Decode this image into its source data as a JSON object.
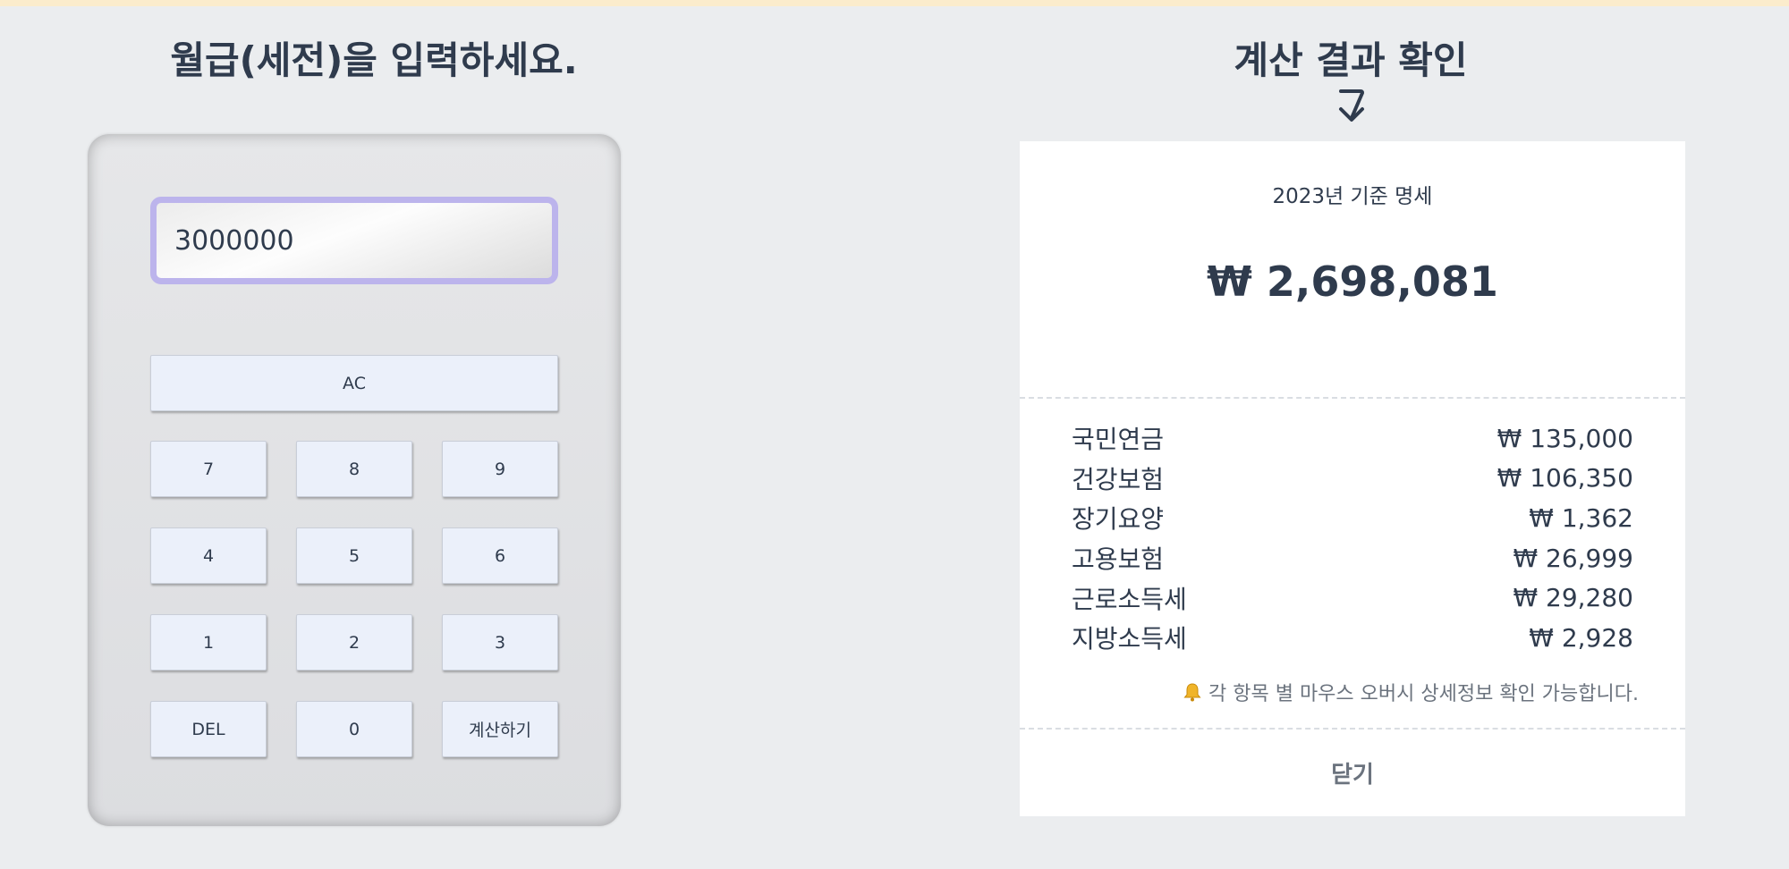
{
  "left_panel": {
    "title": "월급(세전)을 입력하세요."
  },
  "calculator": {
    "input_value": "3000000",
    "keys": {
      "clear": "AC",
      "k7": "7",
      "k8": "8",
      "k9": "9",
      "k4": "4",
      "k5": "5",
      "k6": "6",
      "k1": "1",
      "k2": "2",
      "k3": "3",
      "del": "DEL",
      "k0": "0",
      "calculate": "계산하기"
    }
  },
  "right_panel": {
    "title": "계산 결과 확인",
    "arrow_icon": "curved-arrow-down-icon"
  },
  "result": {
    "basis": "2023년 기준 명세",
    "net_amount": "₩ 2,698,081",
    "deductions": [
      {
        "label": "국민연금",
        "amount": "₩ 135,000"
      },
      {
        "label": "건강보험",
        "amount": "₩ 106,350"
      },
      {
        "label": "장기요양",
        "amount": "₩ 1,362"
      },
      {
        "label": "고용보험",
        "amount": "₩ 26,999"
      },
      {
        "label": "근로소득세",
        "amount": "₩ 29,280"
      },
      {
        "label": "지방소득세",
        "amount": "₩ 2,928"
      }
    ],
    "note_icon": "bell-icon",
    "note": "각 항목 별 마우스 오버시 상세정보 확인 가능합니다.",
    "close_label": "닫기"
  },
  "colors": {
    "background": "#ebedef",
    "text": "#2f3b4d",
    "display_border": "#bcb4ec",
    "key_bg": "#ebf0fa",
    "top_strip": "#fbeccc",
    "bell": "#f0b429"
  }
}
